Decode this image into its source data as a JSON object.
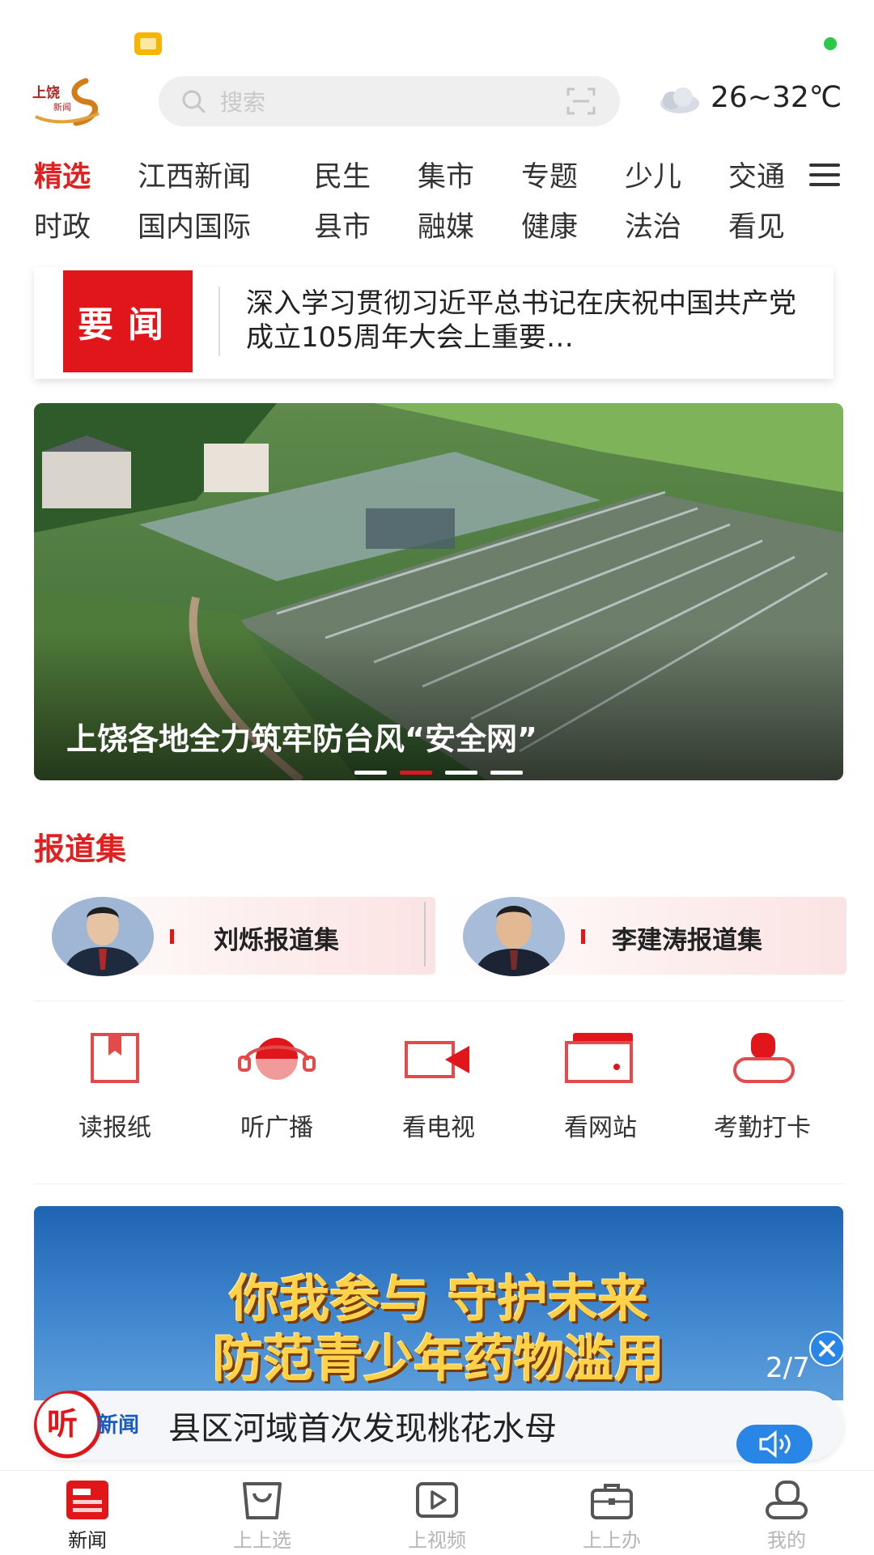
{
  "header": {
    "logo_text_top": "上饶",
    "logo_text_bottom": "新闻",
    "search_placeholder": "搜索",
    "weather_temp": "26~32℃",
    "weather_icon": "cloud-icon"
  },
  "tabs": {
    "row1": [
      "精选",
      "江西新闻",
      "民生",
      "集市",
      "专题",
      "少儿",
      "交通"
    ],
    "row2": [
      "时政",
      "国内国际",
      "县市",
      "融媒",
      "健康",
      "法治",
      "看见"
    ],
    "active": "精选"
  },
  "headline": {
    "badge": "要闻",
    "text": "深入学习贯彻习近平总书记在庆祝中国共产党成立105周年大会上重要…"
  },
  "carousel": {
    "caption": "上饶各地全力筑牢防台风“安全网”",
    "current_index": 2,
    "total": 4
  },
  "reports": {
    "title": "报道集",
    "items": [
      {
        "name": "刘烁报道集"
      },
      {
        "name": "李建涛报道集"
      }
    ]
  },
  "shortcuts": [
    {
      "label": "读报纸",
      "icon": "newspaper-icon"
    },
    {
      "label": "听广播",
      "icon": "radio-headset-icon"
    },
    {
      "label": "看电视",
      "icon": "video-camera-icon"
    },
    {
      "label": "看网站",
      "icon": "website-icon"
    },
    {
      "label": "考勤打卡",
      "icon": "attendance-icon"
    }
  ],
  "banner": {
    "line1": "你我参与 守护未来",
    "line2": "防范青少年药物滥用",
    "page": "2/7"
  },
  "audio": {
    "label_big": "听",
    "label": "新闻",
    "text": "县区河域首次发现桃花水母"
  },
  "bottom_nav": [
    {
      "label": "新闻",
      "icon": "news-icon"
    },
    {
      "label": "上上选",
      "icon": "shopping-bag-icon"
    },
    {
      "label": "上视频",
      "icon": "play-video-icon"
    },
    {
      "label": "上上办",
      "icon": "briefcase-icon"
    },
    {
      "label": "我的",
      "icon": "profile-icon"
    }
  ],
  "colors": {
    "brand_red": "#e0161b",
    "accent_blue": "#2a86e6"
  }
}
